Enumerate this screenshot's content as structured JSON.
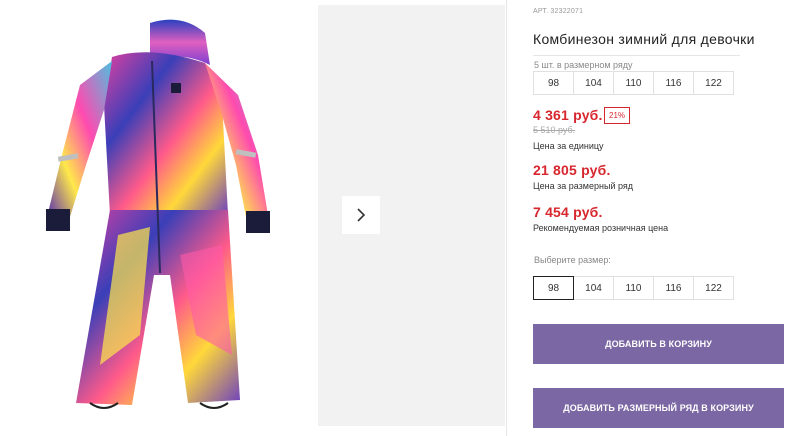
{
  "product": {
    "sku": "АРТ. 32322071",
    "title": "Комбинезон зимний для девочки",
    "set_note": "5 шт. в размерном ряду",
    "set_sizes": [
      "98",
      "104",
      "110",
      "116",
      "122"
    ]
  },
  "prices": {
    "unit_price": "4 361 руб.",
    "discount_badge": "21%",
    "old_price": "5 510 руб.",
    "unit_caption": "Цена за единицу",
    "set_price": "21 805 руб.",
    "set_caption": "Цена за размерный ряд",
    "retail_price": "7 454 руб.",
    "retail_caption": "Рекомендуемая розничная цена"
  },
  "size_picker": {
    "label": "Выберите размер:",
    "options": [
      "98",
      "104",
      "110",
      "116",
      "122"
    ],
    "selected": "98"
  },
  "actions": {
    "add_to_cart": "ДОБАВИТЬ В КОРЗИНУ",
    "add_set_to_cart": "ДОБАВИТЬ РАЗМЕРНЫЙ РЯД В КОРЗИНУ"
  },
  "colors": {
    "accent_red": "#d7262e",
    "button_purple": "#7b67a4"
  },
  "icons": {
    "next": "chevron-right-icon"
  }
}
